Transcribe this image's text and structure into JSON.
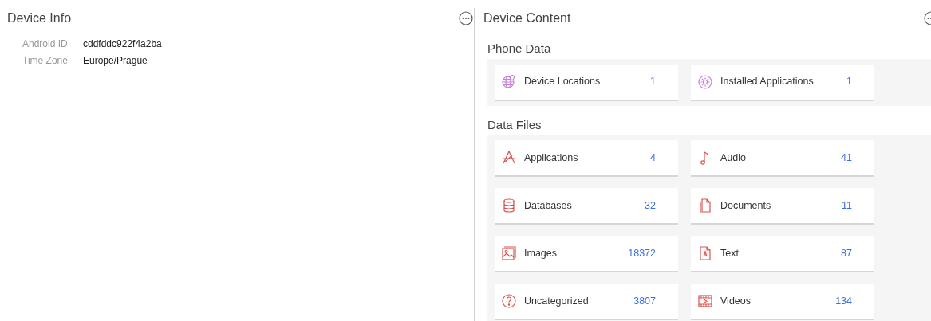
{
  "device_info": {
    "title": "Device Info",
    "fields": [
      {
        "label": "Android ID",
        "value": "cddfddc922f4a2ba"
      },
      {
        "label": "Time Zone",
        "value": "Europe/Prague"
      }
    ]
  },
  "device_content": {
    "title": "Device Content",
    "sections": [
      {
        "title": "Phone Data",
        "tiles": [
          {
            "kind": "location",
            "label": "Device Locations",
            "count": "1"
          },
          {
            "kind": "installed",
            "label": "Installed Applications",
            "count": "1"
          }
        ]
      },
      {
        "title": "Data Files",
        "tiles": [
          {
            "kind": "app",
            "label": "Applications",
            "count": "4"
          },
          {
            "kind": "audio",
            "label": "Audio",
            "count": "41"
          },
          {
            "kind": "database",
            "label": "Databases",
            "count": "32"
          },
          {
            "kind": "document",
            "label": "Documents",
            "count": "11"
          },
          {
            "kind": "image",
            "label": "Images",
            "count": "18372"
          },
          {
            "kind": "text",
            "label": "Text",
            "count": "87"
          },
          {
            "kind": "other",
            "label": "Uncategorized",
            "count": "3807"
          },
          {
            "kind": "video",
            "label": "Videos",
            "count": "134"
          }
        ]
      }
    ]
  }
}
